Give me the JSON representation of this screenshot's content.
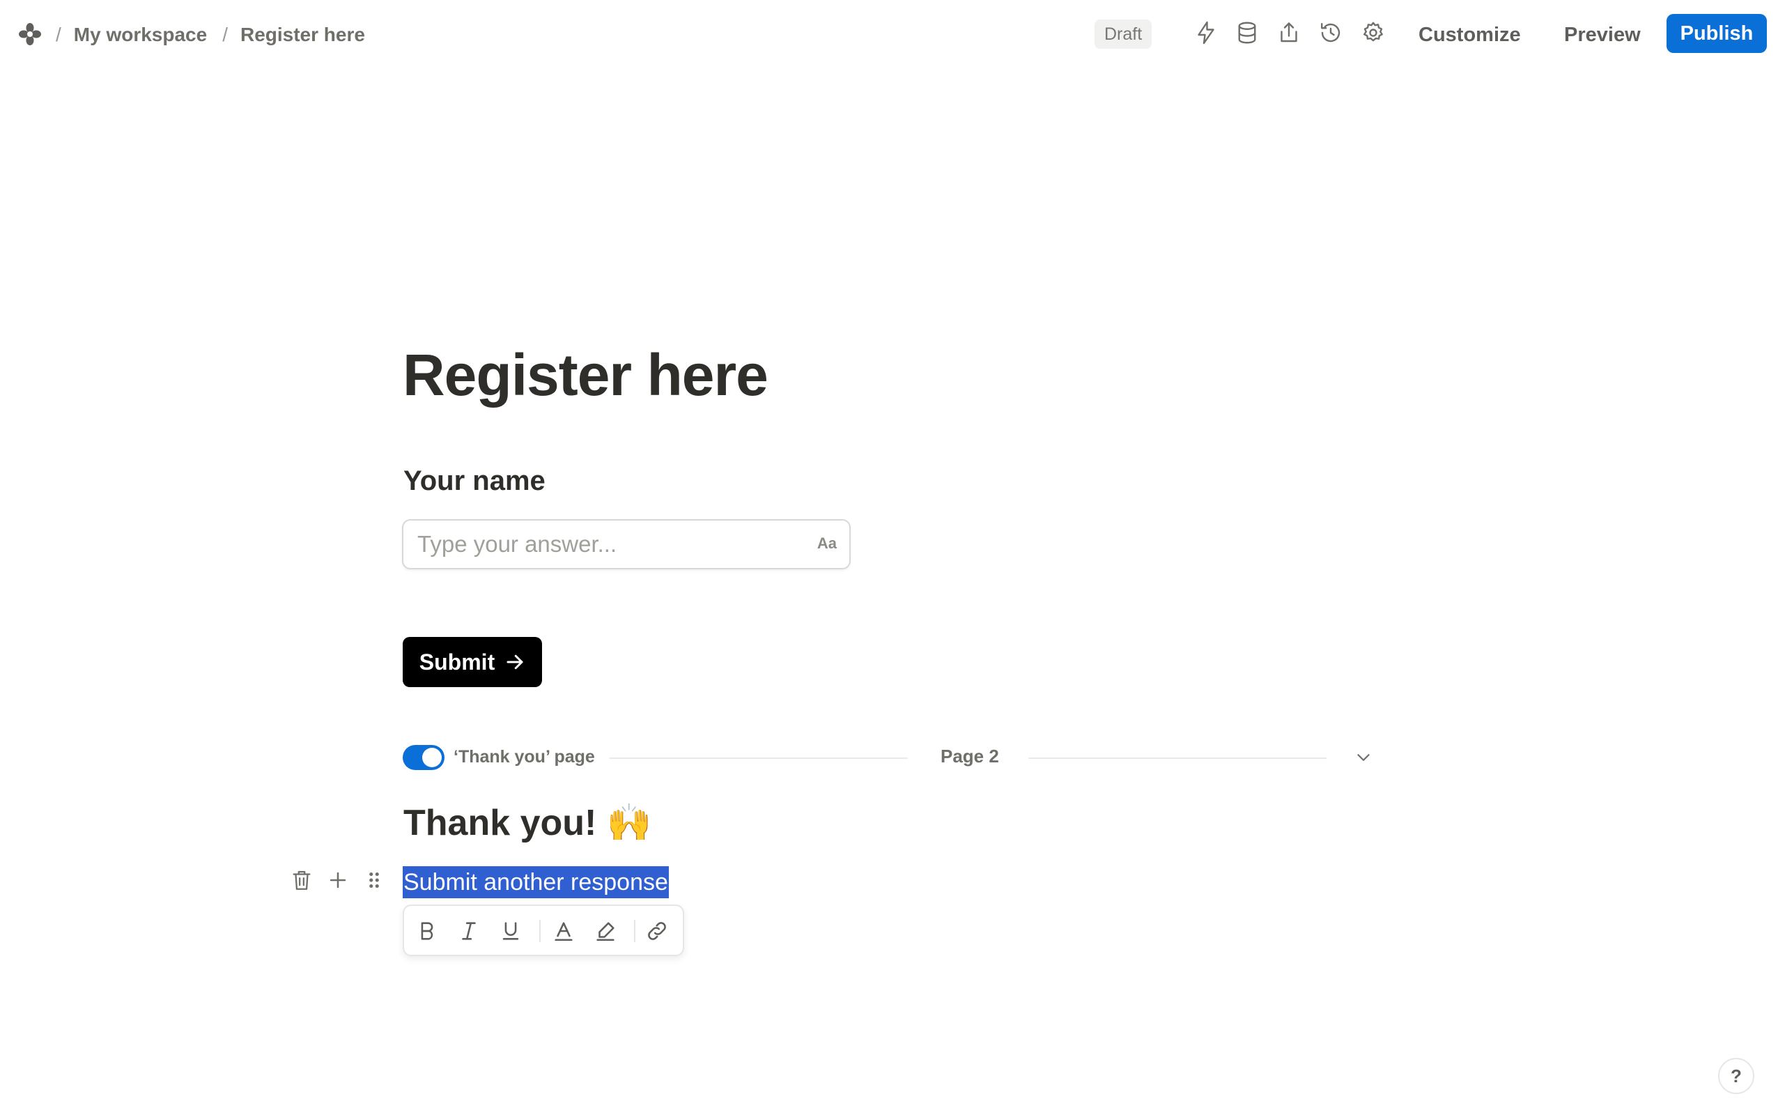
{
  "breadcrumb": {
    "workspace": "My workspace",
    "form": "Register here",
    "separator": "/"
  },
  "header": {
    "status_badge": "Draft",
    "icons": [
      "lightning-icon",
      "database-icon",
      "share-icon",
      "history-icon",
      "gear-icon"
    ],
    "customize_label": "Customize",
    "preview_label": "Preview",
    "publish_label": "Publish",
    "accent_color": "#0a6fd6"
  },
  "form": {
    "title": "Register here",
    "question_label": "Your name",
    "answer_placeholder": "Type your answer...",
    "answer_type_indicator": "Aa",
    "submit_label": "Submit"
  },
  "page_divider": {
    "thank_you_toggle_on": true,
    "thank_you_label": "‘Thank you’ page",
    "page_label": "Page 2"
  },
  "thank_you_page": {
    "heading": "Thank you! 🙌",
    "selected_text": "Submit another response"
  },
  "format_toolbar": {
    "buttons": [
      "bold-icon",
      "italic-icon",
      "underline-icon",
      "text-color-icon",
      "highlight-icon",
      "link-icon"
    ]
  },
  "help": {
    "label": "?"
  }
}
